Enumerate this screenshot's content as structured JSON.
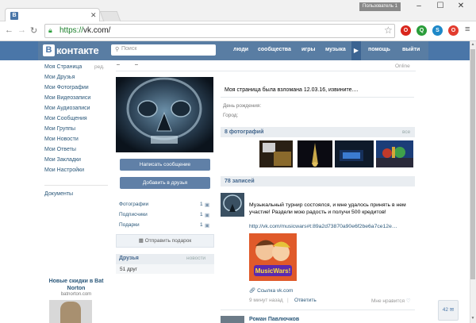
{
  "browser": {
    "tab_icon": "В",
    "user_badge": "Пользователь 1",
    "url_scheme": "https://",
    "url_rest": "vk.com/",
    "ext_badges": [
      "O",
      "Q",
      "S",
      "O"
    ],
    "colors": {
      "ext1": "#d9261c",
      "ext2": "#2a9d3a",
      "ext3": "#1e88c8",
      "ext4": "#e23b2e"
    }
  },
  "vk": {
    "logo_letter": "В",
    "logo_text": "контакте",
    "search_placeholder": "Поиск",
    "nav": [
      "люди",
      "сообщества",
      "игры",
      "музыка",
      "помощь",
      "выйти"
    ],
    "colors": {
      "header": "#4a76a8",
      "link": "#2b587a",
      "button": "#6080a7"
    }
  },
  "left_menu": {
    "items": [
      "Моя Страница",
      "Мои Друзья",
      "Мои Фотографии",
      "Мои Видеозаписи",
      "Мои Аудиозаписи",
      "Мои Сообщения",
      "Мои Группы",
      "Мои Новости",
      "Мои Ответы",
      "Мои Закладки",
      "Мои Настройки"
    ],
    "edit_label": "ред.",
    "documents": "Документы",
    "ad_title": "Новые скидки в Bat Norton",
    "ad_url": "batnorton.com"
  },
  "profile": {
    "name_dash_1": "–",
    "name_dash_2": "–",
    "online": "Online",
    "btn_message": "Написать сообщение",
    "btn_add_friend": "Добавить в друзья",
    "counters": [
      {
        "label": "Фотографии",
        "count": "1"
      },
      {
        "label": "Подписчики",
        "count": "1"
      },
      {
        "label": "Подарки",
        "count": "1"
      }
    ],
    "gift_btn": "Отправить подарок",
    "friends_label": "Друзья",
    "friends_new": "новости",
    "friends_count": "51 друг"
  },
  "info": {
    "status": "Моя страница была взломана 12.03.16, извините....",
    "birthday_label": "День рождения:",
    "city_label": "Город:"
  },
  "photos": {
    "title": "8 фотографий",
    "all": "все"
  },
  "wall": {
    "title": "78 записей",
    "post_text": "Музыкальный турнир состоялся, и мне удалось принять в нем участие! Раздели мою радость и получи 500 кредитов!",
    "post_link": "http://vk.com/musicwars#t:89a2d73870a90e6f2be6a7ce12e…",
    "game_title": "MusicWars!",
    "link_caption": "Ссылка vk.com",
    "post_time": "9 минут назад",
    "reply": "Ответить",
    "like": "Мне нравится",
    "post2_name": "Роман Павлючков"
  },
  "chat": {
    "count": "42"
  }
}
